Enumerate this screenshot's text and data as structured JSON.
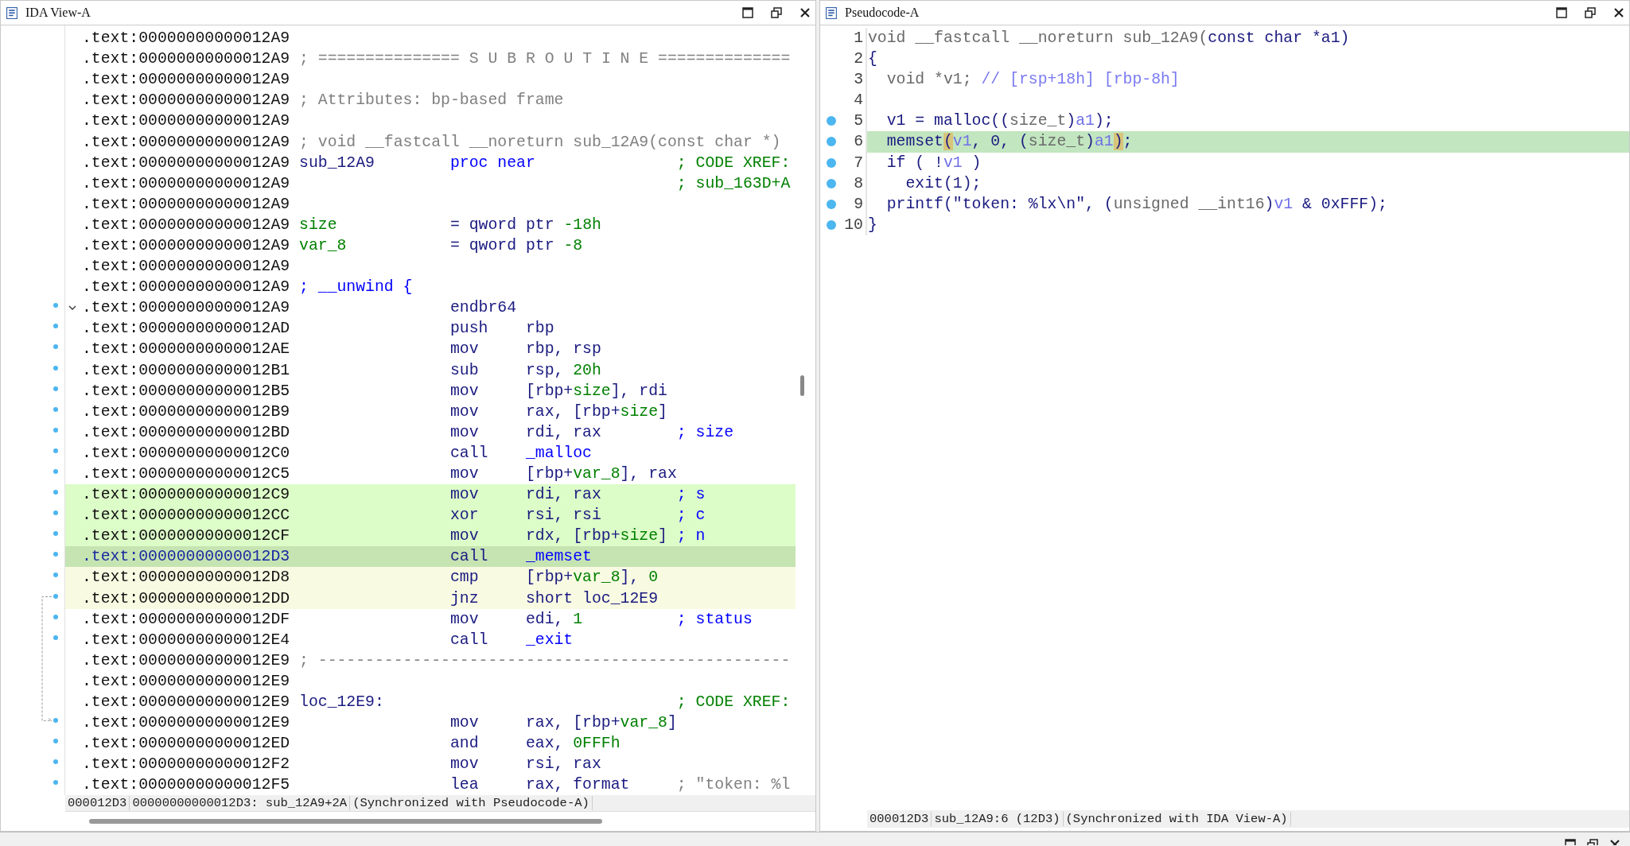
{
  "ida_view": {
    "title": "IDA View-A",
    "rows": [
      {
        "addr": ".text:00000000000012A9",
        "kind": "blank",
        "marker": false,
        "selected": false,
        "current": false,
        "flow_highlight": false,
        "jump_source": false,
        "jump_target": false
      },
      {
        "addr": ".text:00000000000012A9",
        "kind": "comment",
        "marker": false,
        "selected": false,
        "current": false,
        "flow_highlight": false,
        "jump_source": false,
        "jump_target": false,
        "label": {
          "text": "; =============== S U B R O U T I N E ==============",
          "kind": "gray"
        }
      },
      {
        "addr": ".text:00000000000012A9",
        "kind": "blank",
        "marker": false,
        "selected": false,
        "current": false,
        "flow_highlight": false,
        "jump_source": false,
        "jump_target": false
      },
      {
        "addr": ".text:00000000000012A9",
        "kind": "comment",
        "marker": false,
        "selected": false,
        "current": false,
        "flow_highlight": false,
        "jump_source": false,
        "jump_target": false,
        "label": {
          "text": "; Attributes: bp-based frame",
          "kind": "gray"
        }
      },
      {
        "addr": ".text:00000000000012A9",
        "kind": "blank",
        "marker": false,
        "selected": false,
        "current": false,
        "flow_highlight": false,
        "jump_source": false,
        "jump_target": false
      },
      {
        "addr": ".text:00000000000012A9",
        "kind": "comment",
        "marker": false,
        "selected": false,
        "current": false,
        "flow_highlight": false,
        "jump_source": false,
        "jump_target": false,
        "label": {
          "text": "; void __fastcall __noreturn sub_12A9(const char *)",
          "kind": "gray"
        }
      },
      {
        "addr": ".text:00000000000012A9",
        "kind": "insn",
        "marker": false,
        "selected": false,
        "current": false,
        "flow_highlight": false,
        "jump_source": false,
        "jump_target": false,
        "label": {
          "text": "sub_12A9",
          "kind": "navy"
        },
        "mnem": {
          "text": "proc near",
          "kind": "blue"
        },
        "comment": {
          "text": "; CODE XREF:",
          "kind": "green"
        }
      },
      {
        "addr": ".text:00000000000012A9",
        "kind": "insn",
        "marker": false,
        "selected": false,
        "current": false,
        "flow_highlight": false,
        "jump_source": false,
        "jump_target": false,
        "comment": {
          "text": "; sub_163D+A",
          "kind": "green"
        }
      },
      {
        "addr": ".text:00000000000012A9",
        "kind": "blank",
        "marker": false,
        "selected": false,
        "current": false,
        "flow_highlight": false,
        "jump_source": false,
        "jump_target": false
      },
      {
        "addr": ".text:00000000000012A9",
        "kind": "data",
        "marker": false,
        "selected": false,
        "current": false,
        "flow_highlight": false,
        "jump_source": false,
        "jump_target": false,
        "label": {
          "text": "size",
          "kind": "green"
        },
        "mnem": {
          "text": "=",
          "kind": "navy"
        },
        "args": [
          {
            "text": "qword ptr ",
            "kind": "navy"
          },
          {
            "text": "-18h",
            "kind": "green"
          }
        ]
      },
      {
        "addr": ".text:00000000000012A9",
        "kind": "data",
        "marker": false,
        "selected": false,
        "current": false,
        "flow_highlight": false,
        "jump_source": false,
        "jump_target": false,
        "label": {
          "text": "var_8",
          "kind": "green"
        },
        "mnem": {
          "text": "=",
          "kind": "navy"
        },
        "args": [
          {
            "text": "qword ptr ",
            "kind": "navy"
          },
          {
            "text": "-8",
            "kind": "green"
          }
        ]
      },
      {
        "addr": ".text:00000000000012A9",
        "kind": "blank",
        "marker": false,
        "selected": false,
        "current": false,
        "flow_highlight": false,
        "jump_source": false,
        "jump_target": false
      },
      {
        "addr": ".text:00000000000012A9",
        "kind": "comment",
        "marker": false,
        "selected": false,
        "current": false,
        "flow_highlight": false,
        "jump_source": false,
        "jump_target": false,
        "label": {
          "text": "; __unwind {",
          "kind": "blue"
        }
      },
      {
        "addr": ".text:00000000000012A9",
        "kind": "insn",
        "marker": true,
        "expanded": true,
        "selected": false,
        "current": false,
        "flow_highlight": false,
        "jump_source": false,
        "jump_target": false,
        "mnem": {
          "text": "endbr64",
          "kind": "navy"
        }
      },
      {
        "addr": ".text:00000000000012AD",
        "kind": "insn",
        "marker": true,
        "selected": false,
        "current": false,
        "flow_highlight": false,
        "jump_source": false,
        "jump_target": false,
        "mnem": {
          "text": "push",
          "kind": "navy"
        },
        "args": [
          {
            "text": "rbp",
            "kind": "navy"
          }
        ]
      },
      {
        "addr": ".text:00000000000012AE",
        "kind": "insn",
        "marker": true,
        "selected": false,
        "current": false,
        "flow_highlight": false,
        "jump_source": false,
        "jump_target": false,
        "mnem": {
          "text": "mov",
          "kind": "navy"
        },
        "args": [
          {
            "text": "rbp, rsp",
            "kind": "navy"
          }
        ]
      },
      {
        "addr": ".text:00000000000012B1",
        "kind": "insn",
        "marker": true,
        "selected": false,
        "current": false,
        "flow_highlight": false,
        "jump_source": false,
        "jump_target": false,
        "mnem": {
          "text": "sub",
          "kind": "navy"
        },
        "args": [
          {
            "text": "rsp, ",
            "kind": "navy"
          },
          {
            "text": "20h",
            "kind": "green"
          }
        ]
      },
      {
        "addr": ".text:00000000000012B5",
        "kind": "insn",
        "marker": true,
        "selected": false,
        "current": false,
        "flow_highlight": false,
        "jump_source": false,
        "jump_target": false,
        "mnem": {
          "text": "mov",
          "kind": "navy"
        },
        "args": [
          {
            "text": "[rbp+",
            "kind": "navy"
          },
          {
            "text": "size",
            "kind": "green"
          },
          {
            "text": "], rdi",
            "kind": "navy"
          }
        ]
      },
      {
        "addr": ".text:00000000000012B9",
        "kind": "insn",
        "marker": true,
        "selected": false,
        "current": false,
        "flow_highlight": false,
        "jump_source": false,
        "jump_target": false,
        "mnem": {
          "text": "mov",
          "kind": "navy"
        },
        "args": [
          {
            "text": "rax, [rbp+",
            "kind": "navy"
          },
          {
            "text": "size",
            "kind": "green"
          },
          {
            "text": "]",
            "kind": "navy"
          }
        ]
      },
      {
        "addr": ".text:00000000000012BD",
        "kind": "insn",
        "marker": true,
        "selected": false,
        "current": false,
        "flow_highlight": false,
        "jump_source": false,
        "jump_target": false,
        "mnem": {
          "text": "mov",
          "kind": "navy"
        },
        "args": [
          {
            "text": "rdi, rax",
            "kind": "navy"
          }
        ],
        "comment": {
          "text": "; size",
          "kind": "blue"
        }
      },
      {
        "addr": ".text:00000000000012C0",
        "kind": "insn",
        "marker": true,
        "selected": false,
        "current": false,
        "flow_highlight": false,
        "jump_source": false,
        "jump_target": false,
        "mnem": {
          "text": "call",
          "kind": "navy"
        },
        "args": [
          {
            "text": "_malloc",
            "kind": "blue"
          }
        ]
      },
      {
        "addr": ".text:00000000000012C5",
        "kind": "insn",
        "marker": true,
        "selected": false,
        "current": false,
        "flow_highlight": false,
        "jump_source": false,
        "jump_target": false,
        "mnem": {
          "text": "mov",
          "kind": "navy"
        },
        "args": [
          {
            "text": "[rbp+",
            "kind": "navy"
          },
          {
            "text": "var_8",
            "kind": "green"
          },
          {
            "text": "], rax",
            "kind": "navy"
          }
        ]
      },
      {
        "addr": ".text:00000000000012C9",
        "kind": "insn",
        "marker": true,
        "selected": true,
        "current": false,
        "flow_highlight": false,
        "jump_source": false,
        "jump_target": false,
        "mnem": {
          "text": "mov",
          "kind": "navy"
        },
        "args": [
          {
            "text": "rdi, rax",
            "kind": "navy"
          }
        ],
        "comment": {
          "text": "; s",
          "kind": "blue"
        }
      },
      {
        "addr": ".text:00000000000012CC",
        "kind": "insn",
        "marker": true,
        "selected": true,
        "current": false,
        "flow_highlight": false,
        "jump_source": false,
        "jump_target": false,
        "mnem": {
          "text": "xor",
          "kind": "navy"
        },
        "args": [
          {
            "text": "rsi, rsi",
            "kind": "navy"
          }
        ],
        "comment": {
          "text": "; c",
          "kind": "blue"
        }
      },
      {
        "addr": ".text:00000000000012CF",
        "kind": "insn",
        "marker": true,
        "selected": true,
        "current": false,
        "flow_highlight": false,
        "jump_source": false,
        "jump_target": false,
        "mnem": {
          "text": "mov",
          "kind": "navy"
        },
        "args": [
          {
            "text": "rdx, [rbp+",
            "kind": "navy"
          },
          {
            "text": "size",
            "kind": "green"
          },
          {
            "text": "]",
            "kind": "navy"
          }
        ],
        "comment": {
          "text": "; n",
          "kind": "blue"
        }
      },
      {
        "addr": ".text:00000000000012D3",
        "kind": "insn",
        "marker": true,
        "selected": true,
        "current": true,
        "flow_highlight": false,
        "jump_source": false,
        "jump_target": false,
        "mnem": {
          "text": "call",
          "kind": "navy"
        },
        "args": [
          {
            "text": "_memset",
            "kind": "blue"
          }
        ]
      },
      {
        "addr": ".text:00000000000012D8",
        "kind": "insn",
        "marker": true,
        "selected": false,
        "current": false,
        "flow_highlight": true,
        "jump_source": false,
        "jump_target": false,
        "mnem": {
          "text": "cmp",
          "kind": "navy"
        },
        "args": [
          {
            "text": "[rbp+",
            "kind": "navy"
          },
          {
            "text": "var_8",
            "kind": "green"
          },
          {
            "text": "], ",
            "kind": "navy"
          },
          {
            "text": "0",
            "kind": "green"
          }
        ]
      },
      {
        "addr": ".text:00000000000012DD",
        "kind": "insn",
        "marker": true,
        "selected": false,
        "current": false,
        "flow_highlight": true,
        "jump_source": true,
        "jump_target": false,
        "mnem": {
          "text": "jnz",
          "kind": "navy"
        },
        "args": [
          {
            "text": "short loc_12E9",
            "kind": "navy"
          }
        ]
      },
      {
        "addr": ".text:00000000000012DF",
        "kind": "insn",
        "marker": true,
        "selected": false,
        "current": false,
        "flow_highlight": false,
        "jump_source": false,
        "jump_target": false,
        "mnem": {
          "text": "mov",
          "kind": "navy"
        },
        "args": [
          {
            "text": "edi, ",
            "kind": "navy"
          },
          {
            "text": "1",
            "kind": "green"
          }
        ],
        "comment": {
          "text": "; status",
          "kind": "blue"
        }
      },
      {
        "addr": ".text:00000000000012E4",
        "kind": "insn",
        "marker": true,
        "selected": false,
        "current": false,
        "flow_highlight": false,
        "jump_source": false,
        "jump_target": false,
        "mnem": {
          "text": "call",
          "kind": "navy"
        },
        "args": [
          {
            "text": "_exit",
            "kind": "blue"
          }
        ]
      },
      {
        "addr": ".text:00000000000012E9",
        "kind": "comment",
        "marker": false,
        "selected": false,
        "current": false,
        "flow_highlight": false,
        "jump_source": false,
        "jump_target": false,
        "label": {
          "text": "; --------------------------------------------------",
          "kind": "gray"
        }
      },
      {
        "addr": ".text:00000000000012E9",
        "kind": "blank",
        "marker": false,
        "selected": false,
        "current": false,
        "flow_highlight": false,
        "jump_source": false,
        "jump_target": false
      },
      {
        "addr": ".text:00000000000012E9",
        "kind": "insn",
        "marker": false,
        "selected": false,
        "current": false,
        "flow_highlight": false,
        "jump_source": false,
        "jump_target": false,
        "label": {
          "text": "loc_12E9:",
          "kind": "navy"
        },
        "comment": {
          "text": "; CODE XREF:",
          "kind": "green"
        }
      },
      {
        "addr": ".text:00000000000012E9",
        "kind": "insn",
        "marker": true,
        "selected": false,
        "current": false,
        "flow_highlight": false,
        "jump_source": false,
        "jump_target": true,
        "mnem": {
          "text": "mov",
          "kind": "navy"
        },
        "args": [
          {
            "text": "rax, [rbp+",
            "kind": "navy"
          },
          {
            "text": "var_8",
            "kind": "green"
          },
          {
            "text": "]",
            "kind": "navy"
          }
        ]
      },
      {
        "addr": ".text:00000000000012ED",
        "kind": "insn",
        "marker": true,
        "selected": false,
        "current": false,
        "flow_highlight": false,
        "jump_source": false,
        "jump_target": false,
        "mnem": {
          "text": "and",
          "kind": "navy"
        },
        "args": [
          {
            "text": "eax, ",
            "kind": "navy"
          },
          {
            "text": "0FFFh",
            "kind": "green"
          }
        ]
      },
      {
        "addr": ".text:00000000000012F2",
        "kind": "insn",
        "marker": true,
        "selected": false,
        "current": false,
        "flow_highlight": false,
        "jump_source": false,
        "jump_target": false,
        "mnem": {
          "text": "mov",
          "kind": "navy"
        },
        "args": [
          {
            "text": "rsi, rax",
            "kind": "navy"
          }
        ]
      },
      {
        "addr": ".text:00000000000012F5",
        "kind": "insn",
        "marker": true,
        "selected": false,
        "current": false,
        "flow_highlight": false,
        "jump_source": false,
        "jump_target": false,
        "mnem": {
          "text": "lea",
          "kind": "navy"
        },
        "args": [
          {
            "text": "rax, format",
            "kind": "navy"
          }
        ],
        "comment": {
          "text": "; \"token: %l",
          "kind": "gray"
        }
      }
    ],
    "status_bar": [
      "000012D3",
      "00000000000012D3: sub_12A9+2A",
      "(Synchronized with Pseudocode-A)"
    ]
  },
  "pseudocode": {
    "title": "Pseudocode-A",
    "lines": [
      {
        "number": "1",
        "marker": false,
        "highlight": false,
        "parts": [
          {
            "text": "void __fastcall __noreturn sub_12A9(",
            "kind": "type"
          },
          {
            "text": "const char *a1)",
            "kind": "ident"
          }
        ]
      },
      {
        "number": "2",
        "marker": false,
        "highlight": false,
        "parts": [
          {
            "text": "{",
            "kind": "ident"
          }
        ]
      },
      {
        "number": "3",
        "marker": false,
        "highlight": false,
        "parts": [
          {
            "text": "  void *v1; ",
            "kind": "type"
          },
          {
            "text": "// [rsp+18h] [rbp-8h]",
            "kind": "comment"
          }
        ]
      },
      {
        "number": "4",
        "marker": false,
        "highlight": false
      },
      {
        "number": "5",
        "marker": true,
        "highlight": false,
        "parts": [
          {
            "text": "  v1 = malloc((",
            "kind": "ident"
          },
          {
            "text": "size_t",
            "kind": "type"
          },
          {
            "text": ")",
            "kind": "ident"
          },
          {
            "text": "a1",
            "kind": "var"
          },
          {
            "text": ");",
            "kind": "ident"
          }
        ]
      },
      {
        "number": "6",
        "marker": true,
        "highlight": true,
        "parts": [
          {
            "text": "  memset",
            "kind": "ident"
          },
          {
            "text": "(",
            "kind": "match"
          },
          {
            "text": "v1",
            "kind": "var"
          },
          {
            "text": ", 0, (",
            "kind": "ident"
          },
          {
            "text": "size_t",
            "kind": "type"
          },
          {
            "text": ")",
            "kind": "ident"
          },
          {
            "text": "a1",
            "kind": "var"
          },
          {
            "text": ")",
            "kind": "match"
          },
          {
            "text": ";",
            "kind": "ident"
          }
        ]
      },
      {
        "number": "7",
        "marker": true,
        "highlight": false,
        "parts": [
          {
            "text": "  if ( !",
            "kind": "ident"
          },
          {
            "text": "v1",
            "kind": "var"
          },
          {
            "text": " )",
            "kind": "ident"
          }
        ]
      },
      {
        "number": "8",
        "marker": true,
        "highlight": false,
        "parts": [
          {
            "text": "    exit(1);",
            "kind": "ident"
          }
        ]
      },
      {
        "number": "9",
        "marker": true,
        "highlight": false,
        "parts": [
          {
            "text": "  printf(\"token: %lx\\n\", (",
            "kind": "ident"
          },
          {
            "text": "unsigned __int16",
            "kind": "type"
          },
          {
            "text": ")",
            "kind": "ident"
          },
          {
            "text": "v1",
            "kind": "var"
          },
          {
            "text": " & 0xFFF);",
            "kind": "ident"
          }
        ]
      },
      {
        "number": "10",
        "marker": true,
        "highlight": false,
        "parts": [
          {
            "text": "}",
            "kind": "ident"
          }
        ]
      }
    ],
    "status_bar": [
      "000012D3",
      "sub_12A9:6 (12D3)",
      "(Synchronized with IDA View-A)"
    ]
  }
}
